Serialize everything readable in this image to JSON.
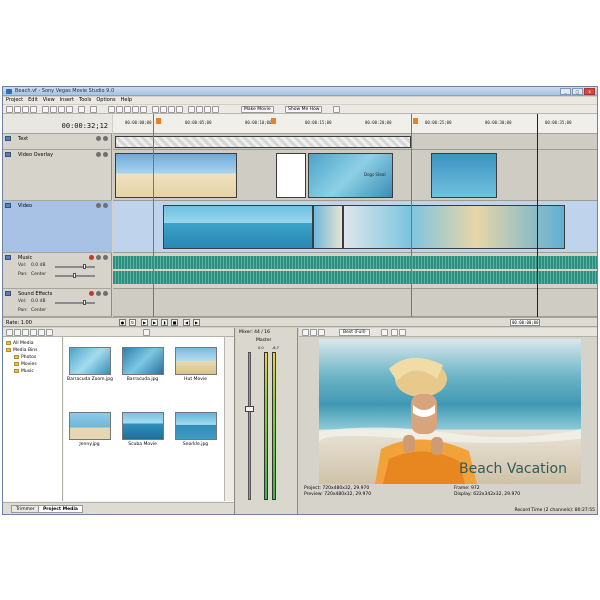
{
  "window": {
    "title": "Beach.vf - Sony Vegas Movie Studio 9.0",
    "controls": [
      "_",
      "□",
      "x"
    ]
  },
  "menubar": [
    "Project",
    "Edit",
    "View",
    "Insert",
    "Tools",
    "Options",
    "Help"
  ],
  "toolbar": {
    "make_movie": "Make Movie",
    "show_me_how": "Show Me How"
  },
  "timecode": "00:00:32;12",
  "ruler": {
    "labels": [
      "00:00:00;00",
      "00:00:05;00",
      "00:00:10;00",
      "00:00:15;00",
      "00:00:20;00",
      "00:00:25;00",
      "00:00:30;00",
      "00:00:35;00"
    ]
  },
  "tracks": [
    {
      "num": "1",
      "name": "Text"
    },
    {
      "num": "2",
      "name": "Video Overlay"
    },
    {
      "num": "3",
      "name": "Video"
    },
    {
      "num": "4",
      "name": "Music",
      "vol_label": "Vol:",
      "vol_value": "0.0 dB",
      "pan_label": "Pan:",
      "pan_value": "Center"
    },
    {
      "num": "5",
      "name": "Sound Effects",
      "vol_label": "Vol:",
      "vol_value": "0.0 dB",
      "pan_label": "Pan:",
      "pan_value": "Center"
    }
  ],
  "timeline": {
    "overlay_clip_label": "Dogs Steal"
  },
  "transport": {
    "rate": "Rate: 1.00",
    "timecode": "00:00:00;00"
  },
  "explorer": {
    "tree": [
      "All Media",
      "Media Bins",
      "Photos",
      "Movies",
      "Music"
    ],
    "items": [
      {
        "caption": "Barracuda Zoom.jpg"
      },
      {
        "caption": "Barracuda.jpg"
      },
      {
        "caption": "Hut Movie"
      },
      {
        "caption": "Jenny.jpg"
      },
      {
        "caption": "Scuba Movie"
      },
      {
        "caption": "Snorkle.jpg"
      }
    ],
    "tabs": [
      "Trimmer",
      "Project Media"
    ]
  },
  "mixer": {
    "header": "Mixer: 44 / 16",
    "master": "Master",
    "db_left": "0.0",
    "db_right": "-6.7"
  },
  "preview": {
    "quality": "Best (Full)",
    "caption": "Beach Vacation",
    "project_label": "Project:",
    "project_value": "720x480x32, 29.970",
    "preview_label": "Preview:",
    "preview_value": "720x480x32, 29.970",
    "frame_label": "Frame:",
    "frame_value": "972",
    "display_label": "Display:",
    "display_value": "622x342x32, 29.970",
    "record_time": "Record Time (2 channels): 80:27:55"
  },
  "colors": {
    "waveform": "#2f8f7e",
    "cursor": "#e0531e",
    "marker": "#e8822a",
    "caption": "#2e5d5b"
  }
}
